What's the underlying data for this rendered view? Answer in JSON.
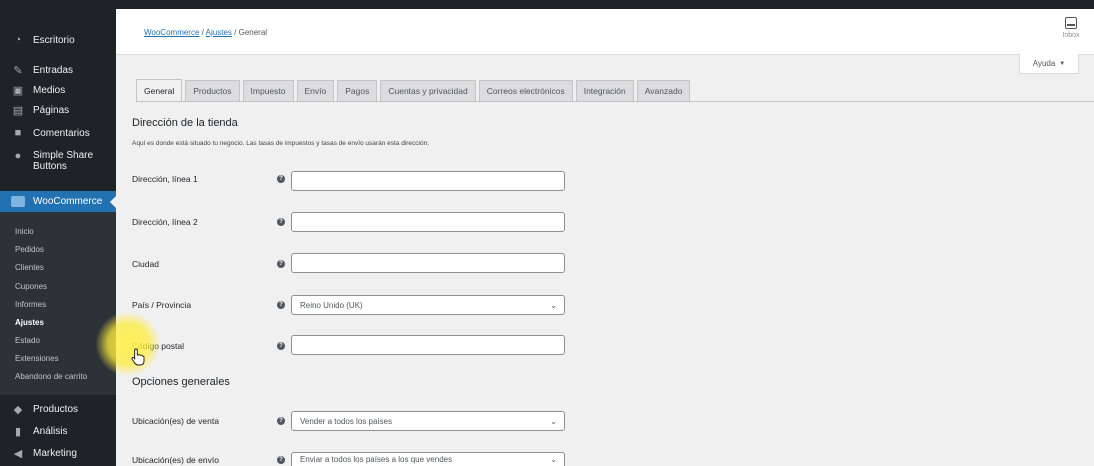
{
  "sidebar": {
    "items": [
      {
        "label": "Escritorio",
        "icon": "dashboard-icon"
      },
      {
        "label": "Entradas",
        "icon": "pin-icon"
      },
      {
        "label": "Medios",
        "icon": "media-icon"
      },
      {
        "label": "Páginas",
        "icon": "page-icon"
      },
      {
        "label": "Comentarios",
        "icon": "comment-icon"
      },
      {
        "label": "Simple Share Buttons",
        "icon": "share-icon"
      }
    ],
    "active": {
      "label": "WooCommerce",
      "icon": "woocommerce-icon"
    },
    "submenu": [
      "Inicio",
      "Pedidos",
      "Clientes",
      "Cupones",
      "Informes",
      "Ajustes",
      "Estado",
      "Extensiones",
      "Abandono de carrito"
    ],
    "current_submenu": "Ajustes",
    "after": [
      {
        "label": "Productos",
        "icon": "products-icon"
      },
      {
        "label": "Análisis",
        "icon": "analytics-icon"
      },
      {
        "label": "Marketing",
        "icon": "marketing-icon"
      }
    ]
  },
  "breadcrumb": {
    "root": "WooCommerce",
    "section": "Ajustes",
    "current": "General",
    "separator": "/"
  },
  "inbox": {
    "label": "Inbox"
  },
  "help": {
    "label": "Ayuda",
    "arrow": "▼"
  },
  "tabs": [
    "General",
    "Productos",
    "Impuesto",
    "Envío",
    "Pagos",
    "Cuentas y privacidad",
    "Correos electrónicos",
    "Integración",
    "Avanzado"
  ],
  "active_tab": "General",
  "store_address": {
    "title": "Dirección de la tienda",
    "description": "Aquí es donde está situado tu negocio. Las tasas de impuestos y tasas de envío usarán esta dirección.",
    "fields": [
      {
        "label": "Dirección, línea 1",
        "value": "",
        "type": "text"
      },
      {
        "label": "Dirección, línea 2",
        "value": "",
        "type": "text"
      },
      {
        "label": "Ciudad",
        "value": "",
        "type": "text"
      },
      {
        "label": "País / Provincia",
        "value": "Reino Unido (UK)",
        "type": "select"
      },
      {
        "label": "Código postal",
        "value": "",
        "type": "text"
      }
    ]
  },
  "general_options": {
    "title": "Opciones generales",
    "fields": [
      {
        "label": "Ubicación(es) de venta",
        "value": "Vender a todos los países",
        "type": "select"
      },
      {
        "label": "Ubicación(es) de envío",
        "value": "Enviar a todos los países a los que vendes",
        "type": "select"
      }
    ]
  },
  "colors": {
    "sidebar": "#1d2327",
    "accent": "#2271b1",
    "highlight": "#ffec3c"
  }
}
